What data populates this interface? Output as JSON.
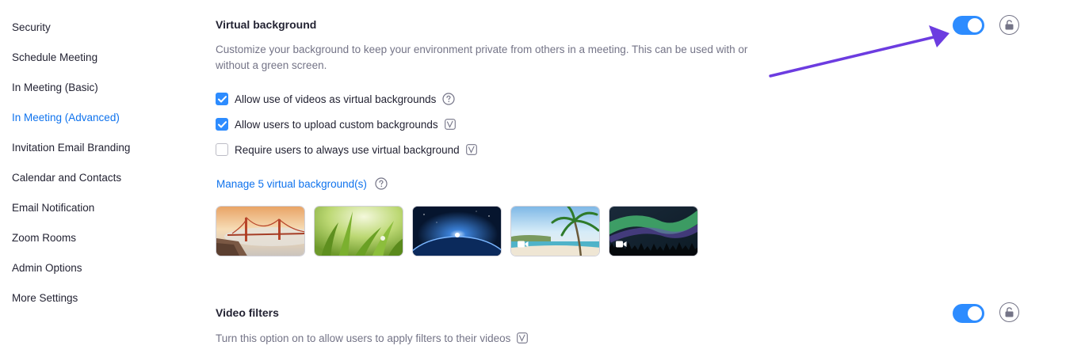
{
  "sidebar": {
    "items": [
      {
        "label": "Security",
        "active": false
      },
      {
        "label": "Schedule Meeting",
        "active": false
      },
      {
        "label": "In Meeting (Basic)",
        "active": false
      },
      {
        "label": "In Meeting (Advanced)",
        "active": true
      },
      {
        "label": "Invitation Email Branding",
        "active": false
      },
      {
        "label": "Calendar and Contacts",
        "active": false
      },
      {
        "label": "Email Notification",
        "active": false
      },
      {
        "label": "Zoom Rooms",
        "active": false
      },
      {
        "label": "Admin Options",
        "active": false
      },
      {
        "label": "More Settings",
        "active": false
      }
    ],
    "accent_color": "#0e72ed"
  },
  "virtual_background": {
    "title": "Virtual background",
    "description": "Customize your background to keep your environment private from others in a meeting. This can be used with or without a green screen.",
    "enabled": true,
    "options": [
      {
        "label": "Allow use of videos as virtual backgrounds",
        "checked": true,
        "icon": "help-icon"
      },
      {
        "label": "Allow users to upload custom backgrounds",
        "checked": true,
        "icon": "version-icon"
      },
      {
        "label": "Require users to always use virtual background",
        "checked": false,
        "icon": "version-icon"
      }
    ],
    "manage_link": "Manage 5 virtual background(s)",
    "thumbnails": [
      {
        "name": "golden-gate-bridge",
        "video": false
      },
      {
        "name": "green-grass",
        "video": false
      },
      {
        "name": "earth-from-space",
        "video": false
      },
      {
        "name": "beach-palm-tree",
        "video": true
      },
      {
        "name": "northern-lights",
        "video": true
      }
    ]
  },
  "video_filters": {
    "title": "Video filters",
    "description": "Turn this option on to allow users to apply filters to their videos",
    "enabled": true
  },
  "colors": {
    "toggle_on": "#2d8cff",
    "annotation_arrow": "#6c3ce0"
  }
}
